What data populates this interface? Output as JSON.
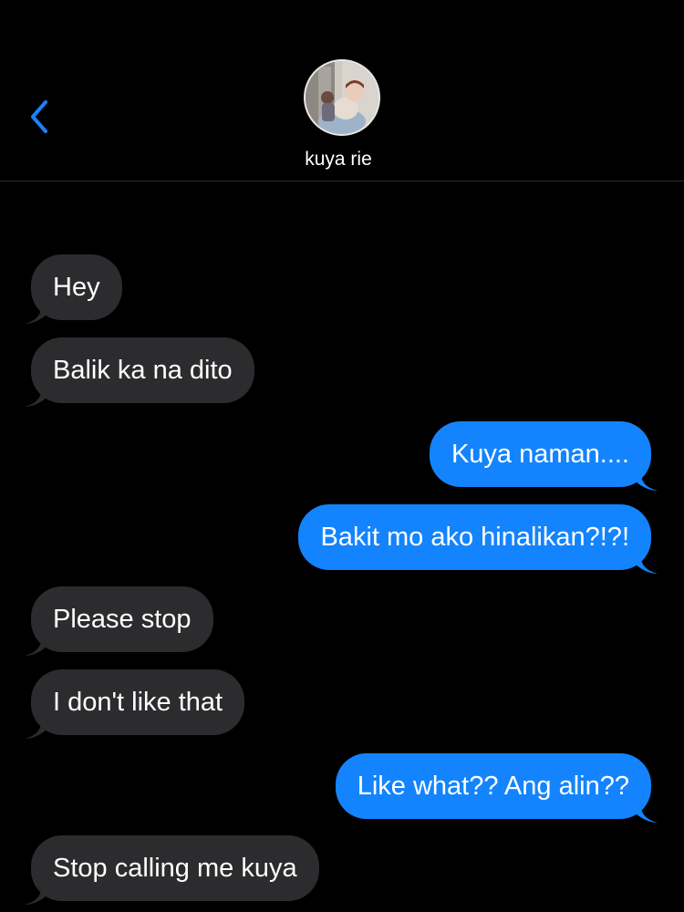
{
  "header": {
    "contact_name": "kuya rie",
    "back_icon": "chevron-left-icon",
    "avatar_icon": "contact-avatar"
  },
  "colors": {
    "background": "#000000",
    "incoming_bubble": "#2c2c2e",
    "outgoing_bubble": "#1384fe",
    "accent": "#1a82fb"
  },
  "messages": [
    {
      "direction": "incoming",
      "text": "Hey"
    },
    {
      "direction": "incoming",
      "text": "Balik ka na dito"
    },
    {
      "direction": "outgoing",
      "text": "Kuya naman...."
    },
    {
      "direction": "outgoing",
      "text": "Bakit mo ako hinalikan?!?!"
    },
    {
      "direction": "incoming",
      "text": "Please stop"
    },
    {
      "direction": "incoming",
      "text": "I don't like that"
    },
    {
      "direction": "outgoing",
      "text": "Like what?? Ang alin??"
    },
    {
      "direction": "incoming",
      "text": "Stop calling me kuya"
    }
  ]
}
